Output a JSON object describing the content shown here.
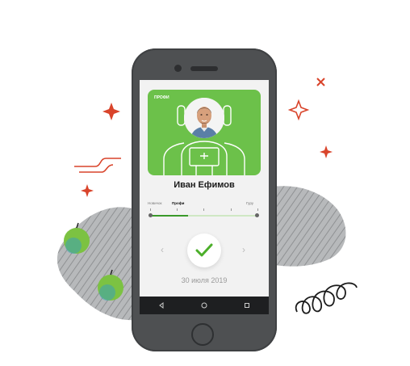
{
  "card": {
    "level_label": "ПРОФИ"
  },
  "user": {
    "name": "Иван Ефимов"
  },
  "progress": {
    "levels": [
      "Новичок",
      "Профи",
      "Гуру"
    ],
    "active_level": "Профи",
    "fill_fraction": 0.35
  },
  "date_text": "30 июля 2019",
  "icons": {
    "prev": "chevron-left-icon",
    "next": "chevron-right-icon",
    "confirm": "checkmark-icon",
    "back": "back-triangle-icon",
    "home": "home-circle-icon",
    "recents": "recents-square-icon"
  },
  "colors": {
    "accent_green": "#6cc14a",
    "check_green": "#4caf2a",
    "sparkle_red": "#d9442b",
    "phone_body": "#4e5052"
  }
}
